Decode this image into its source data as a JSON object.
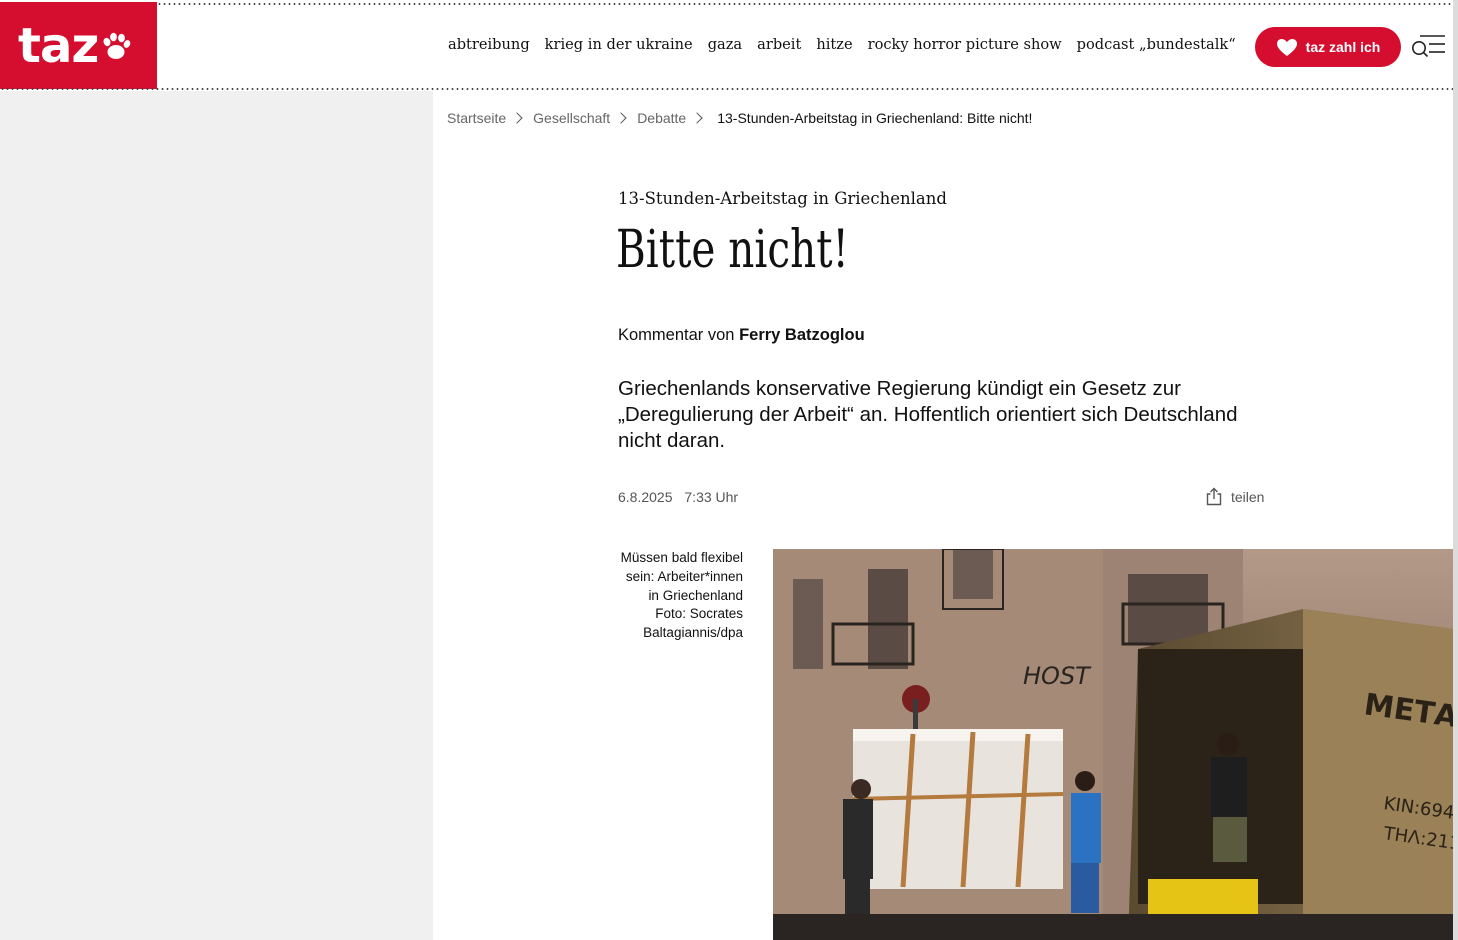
{
  "colors": {
    "brand": "#d50d2e",
    "sidebar_gray": "#f0f0f0"
  },
  "header": {
    "logo_text": "taz",
    "logo_icon": "paw-icon",
    "nav": [
      "abtreibung",
      "krieg in der ukraine",
      "gaza",
      "arbeit",
      "hitze",
      "rocky horror picture show",
      "podcast „bundestalk“"
    ],
    "donate_label": "taz zahl ich",
    "donate_icon": "heart-icon",
    "menu_icon": "search-menu-icon"
  },
  "breadcrumb": [
    "Startseite",
    "Gesellschaft",
    "Debatte"
  ],
  "breadcrumb_current": "13-Stunden-Arbeitstag in Griechenland: Bitte nicht!",
  "article": {
    "kicker": "13-Stunden-Arbeitstag in Griechenland",
    "headline": "Bitte nicht!",
    "byline_prefix": "Kommentar von",
    "author": "Ferry Batzoglou",
    "lead": "Griechenlands konservative Regierung kündigt ein Gesetz zur „Deregulierung der Arbeit“ an. Hoffentlich orientiert sich Deutschland nicht daran.",
    "date": "6.8.2025",
    "time": "7:33 Uhr",
    "share_label": "teilen",
    "share_icon": "share-icon"
  },
  "image": {
    "caption_lines": [
      "Müssen bald flexibel",
      "sein: Arbeiter*innen",
      "in Griechenland",
      "Foto: Socrates",
      "Baltagiannis/dpa"
    ]
  }
}
